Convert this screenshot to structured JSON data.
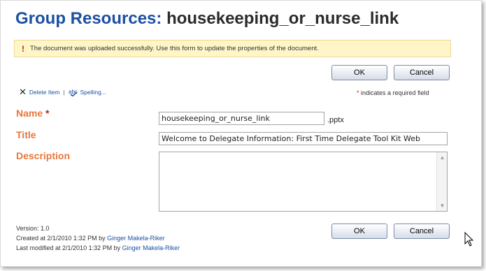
{
  "header": {
    "title_group": "Group Resources",
    "title_sep": ":",
    "title_item": "housekeeping_or_nurse_link"
  },
  "notice": {
    "icon": "!",
    "text": "The document was uploaded successfully. Use this form to update the properties of the document."
  },
  "buttons": {
    "ok": "OK",
    "cancel": "Cancel"
  },
  "toolbar": {
    "delete_label": "Delete Item",
    "divider": "|",
    "spelling_label": "Spelling..."
  },
  "required_note": {
    "star": "*",
    "text": "indicates a required field"
  },
  "fields": {
    "name": {
      "label": "Name",
      "star": "*",
      "value": "housekeeping_or_nurse_link",
      "extension": ".pptx"
    },
    "title": {
      "label": "Title",
      "value": "Welcome to Delegate Information: First Time Delegate Tool Kit Web"
    },
    "description": {
      "label": "Description",
      "value": ""
    }
  },
  "meta": {
    "version": "Version: 1.0",
    "created_prefix": "Created at 2/1/2010 1:32 PM  by",
    "created_by": "Ginger Makela-Riker",
    "modified_prefix": "Last modified at 2/1/2010 1:32 PM  by",
    "modified_by": "Ginger Makela-Riker"
  },
  "colors": {
    "title_blue": "#1d50a3",
    "label_orange": "#e8773d",
    "required_red": "#cc2200",
    "notice_bg": "#fff6c8"
  },
  "icons": {
    "notice": "exclamation-icon",
    "delete": "delete-x-icon",
    "spelling": "spelling-check-icon",
    "cursor": "mouse-pointer-icon"
  }
}
